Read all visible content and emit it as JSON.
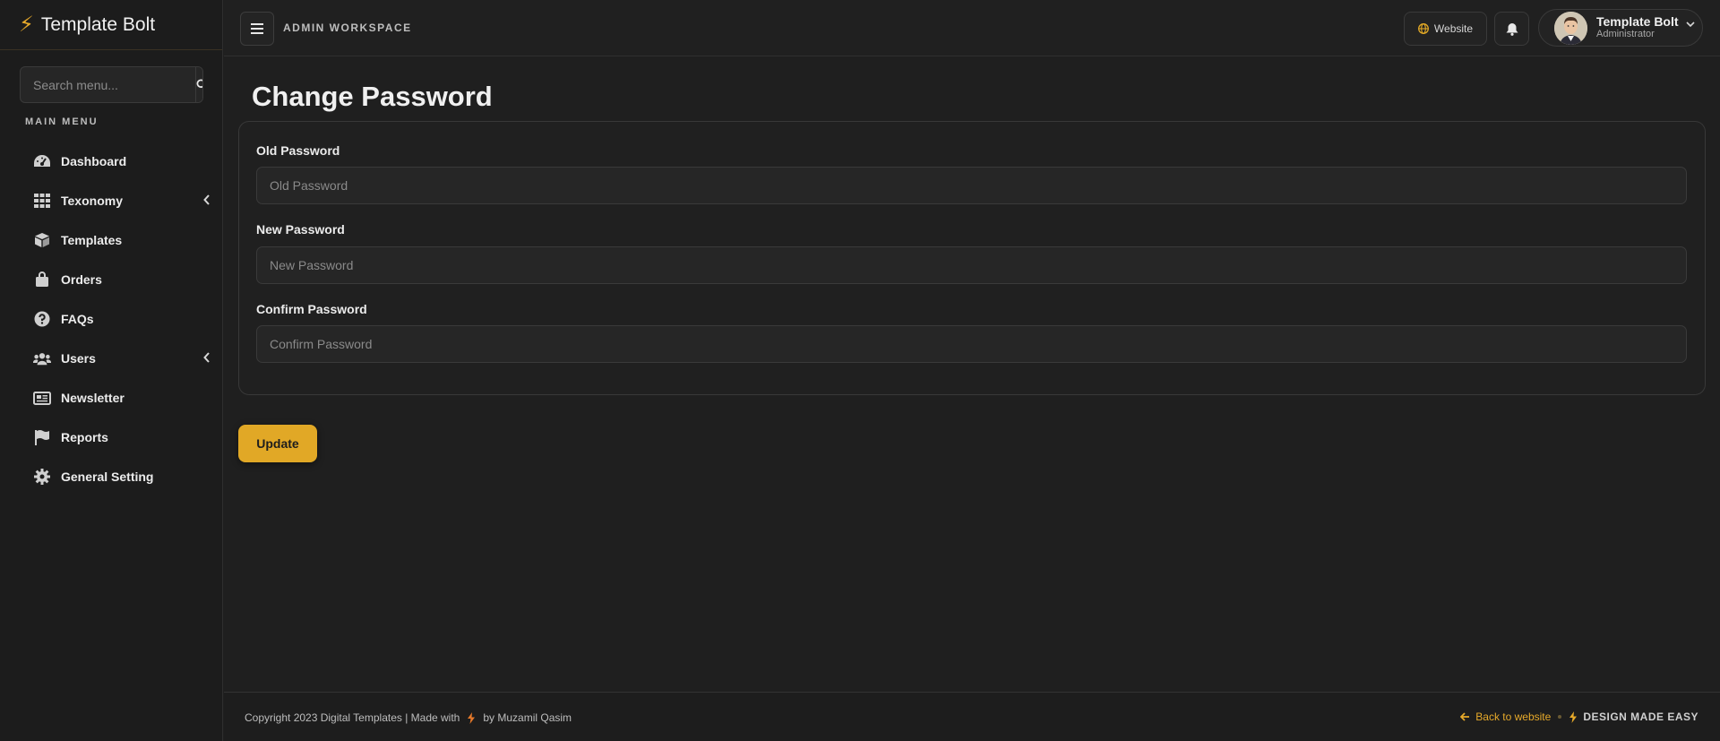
{
  "brand": {
    "name": "Template Bolt"
  },
  "sidebar": {
    "search_placeholder": "Search menu...",
    "menu_title": "MAIN MENU",
    "items": [
      {
        "label": "Dashboard",
        "icon": "dashboard-icon"
      },
      {
        "label": "Texonomy",
        "icon": "grid-icon",
        "has_submenu": true
      },
      {
        "label": "Templates",
        "icon": "box-icon"
      },
      {
        "label": "Orders",
        "icon": "shopping-bag-icon"
      },
      {
        "label": "FAQs",
        "icon": "question-circle-icon"
      },
      {
        "label": "Users",
        "icon": "users-icon",
        "has_submenu": true
      },
      {
        "label": "Newsletter",
        "icon": "newspaper-icon"
      },
      {
        "label": "Reports",
        "icon": "flag-icon"
      },
      {
        "label": "General Setting",
        "icon": "gear-icon"
      }
    ]
  },
  "topbar": {
    "workspace": "ADMIN WORKSPACE",
    "website_label": "Website",
    "user_name": "Template Bolt",
    "user_role": "Administrator"
  },
  "main": {
    "title": "Change Password",
    "fields": [
      {
        "label": "Old Password",
        "placeholder": "Old Password",
        "value": ""
      },
      {
        "label": "New Password",
        "placeholder": "New Password",
        "value": ""
      },
      {
        "label": "Confirm Password",
        "placeholder": "Confirm Password",
        "value": ""
      }
    ],
    "update_label": "Update"
  },
  "footer": {
    "copyright": "Copyright 2023 Digital Templates | Made with",
    "author": "by Muzamil Qasim",
    "back_link": "Back to website",
    "tagline": "DESIGN MADE EASY"
  },
  "colors": {
    "accent": "#e1a826",
    "background": "#1f1f1f",
    "sidebar": "#1c1c1c"
  }
}
